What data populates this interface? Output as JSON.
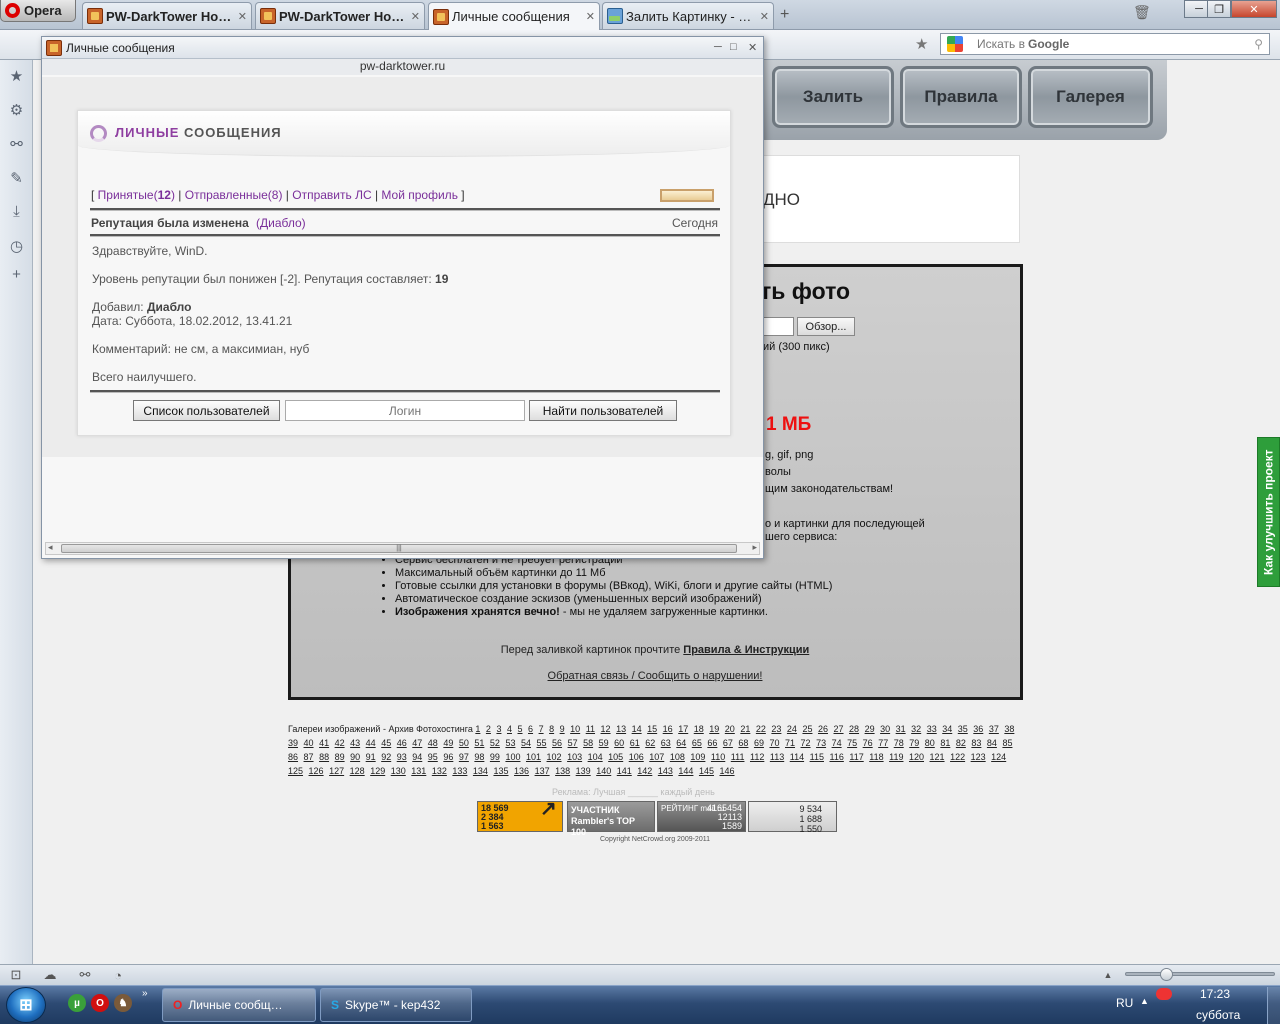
{
  "browser": {
    "menu_label": "Opera",
    "tabs": [
      {
        "title": "PW-DarkTower Нов…",
        "bold": true
      },
      {
        "title": "PW-DarkTower Нов…",
        "bold": true
      },
      {
        "title": "Личные сообщения",
        "bold": false
      },
      {
        "title": "Залить Картинку - За…",
        "bold": false
      }
    ],
    "search_placeholder": "Искать в",
    "search_engine": "Google"
  },
  "site": {
    "nav": [
      "Залить",
      "Правила",
      "Галерея"
    ],
    "white_box_text": "ДНО",
    "upload_heading": "ть фото",
    "browse_label": "Обзор...",
    "thumb_size_text": "ий (300 пикс)",
    "max_size": "1 МБ",
    "formats": "g, gif, png",
    "line_symbols": "волы",
    "line_law": "щим законодательствам!",
    "line_purpose": "о и картинки для последующей",
    "line_service": "шего сервиса:",
    "features": [
      {
        "text": "Сервис бесплатен и не требует регистрации",
        "bold_prefix": ""
      },
      {
        "text": "Максимальный объём картинки до 11 Мб",
        "bold_prefix": ""
      },
      {
        "text": "Готовые ссылки для установки в форумы (ВВкод), WiKi, блоги и другие сайты (HTML)",
        "bold_prefix": ""
      },
      {
        "text": "Автоматическое создание эскизов (уменьшенных версий изображений)",
        "bold_prefix": ""
      },
      {
        "text": " - мы не удаляем загруженные картинки.",
        "bold_prefix": "Изображения хранятся вечно!"
      }
    ],
    "rules_prefix": "Перед заливкой картинок прочтите",
    "rules_link": "Правила & Инструкции",
    "feedback_link": "Обратная связь / Сообщить о нарушении!",
    "gallery_label": "Галереи изображений - Архив Фотохостинга",
    "gallery_pages_count": 146,
    "ad_text": "Реклама: Лучшая ______ каждый день",
    "counter1": [
      "18 569",
      "2 384",
      "1 563"
    ],
    "rambler_label": "УЧАСТНИК Rambler's TOP 100",
    "mailru_label": "РЕЙТИНГ mail.ru",
    "mailru_values": [
      "4165454",
      "12113",
      "1589"
    ],
    "counter3": [
      "9 534",
      "1 688",
      "1 550"
    ],
    "copyright": "Copyright NetCrowd.org 2009-2011",
    "side_button": "Как улучшить проект"
  },
  "popup": {
    "window_title": "Личные сообщения",
    "url": "pw-darktower.ru",
    "panel_title_part1": "ЛИЧНЫЕ",
    "panel_title_part2": "СООБЩЕНИЯ",
    "tabs": {
      "received": "Принятые(",
      "received_count": "12",
      "sent": "Отправленные(",
      "sent_count": "8",
      "send": "Отправить ЛС",
      "profile": "Мой профиль"
    },
    "message": {
      "subject": "Репутация была изменена",
      "from": "(Диабло)",
      "date": "Сегодня",
      "greeting": "Здравствуйте, WinD.",
      "rep_text": "Уровень репутации был понижен [-2]. Репутация составляет:",
      "rep_value": "19",
      "added_by_label": "Добавил:",
      "added_by": "Диабло",
      "date_line": "Дата: Суббота, 18.02.2012, 13.41.21",
      "comment": "Комментарий: не см, а максимиан, нуб",
      "closing": "Всего наилучшего."
    },
    "user_list_button": "Список пользователей",
    "login_placeholder": "Логин",
    "find_user_button": "Найти пользователей"
  },
  "taskbar": {
    "tasks": [
      "Личные сообщ…",
      "Skype™ - kep432"
    ],
    "lang": "RU",
    "time": "17:23",
    "day": "суббота"
  }
}
